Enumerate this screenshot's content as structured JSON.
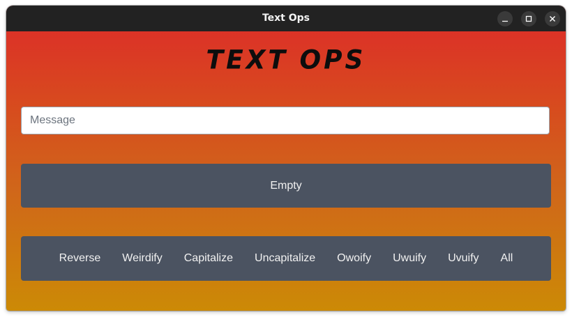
{
  "window": {
    "title": "Text Ops",
    "controls": [
      "minimize",
      "maximize",
      "close"
    ]
  },
  "app": {
    "heading": "TEXT OPS",
    "message_input": {
      "value": "",
      "placeholder": "Message"
    },
    "output": "Empty",
    "operations": [
      "Reverse",
      "Weirdify",
      "Capitalize",
      "Uncapitalize",
      "Owoify",
      "Uwuify",
      "Uvuify",
      "All"
    ]
  },
  "colors": {
    "titlebar": "#222222",
    "gradient_top": "#dd2a2a",
    "gradient_bottom": "#cc8a06",
    "panel": "#4b5361"
  }
}
